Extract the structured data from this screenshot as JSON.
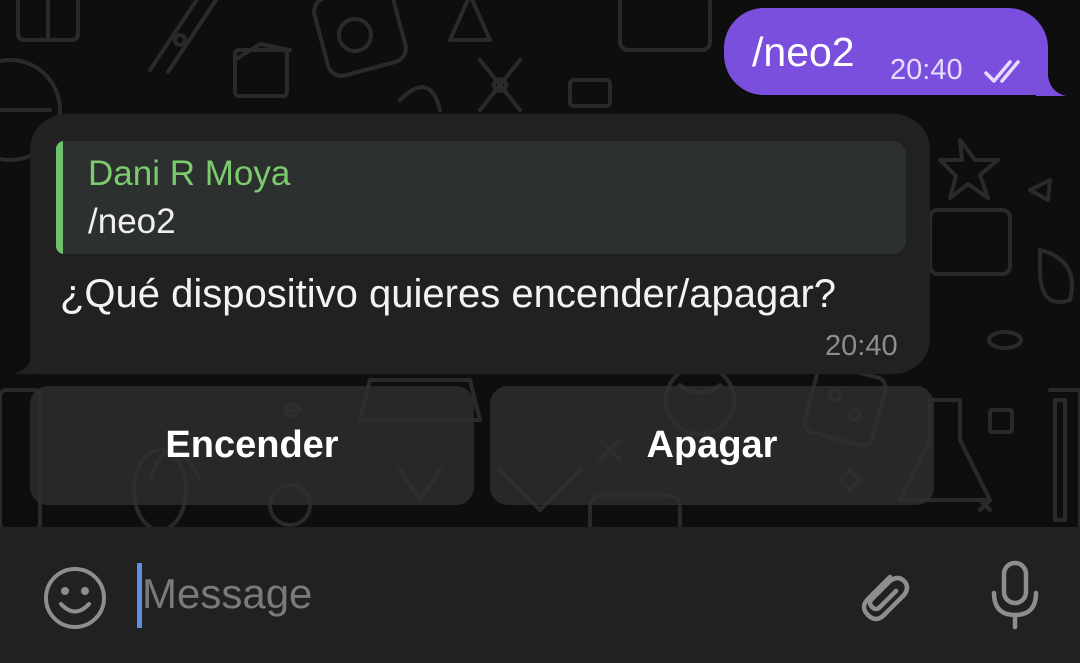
{
  "outgoing_message": {
    "text": "/neo2",
    "time": "20:40",
    "status_icon": "double-check-icon",
    "bubble_color": "#7b4fdd"
  },
  "incoming_message": {
    "reply_to": {
      "sender": "Dani R Moya",
      "text": "/neo2",
      "accent_color": "#6fc16d"
    },
    "text": "¿Qué dispositivo quieres encender/apagar?",
    "time": "20:40"
  },
  "keyboard": {
    "buttons": [
      "Encender",
      "Apagar"
    ]
  },
  "input_bar": {
    "placeholder": "Message",
    "value": "",
    "emoji_icon": "smiley-icon",
    "attach_icon": "paperclip-icon",
    "mic_icon": "microphone-icon"
  }
}
